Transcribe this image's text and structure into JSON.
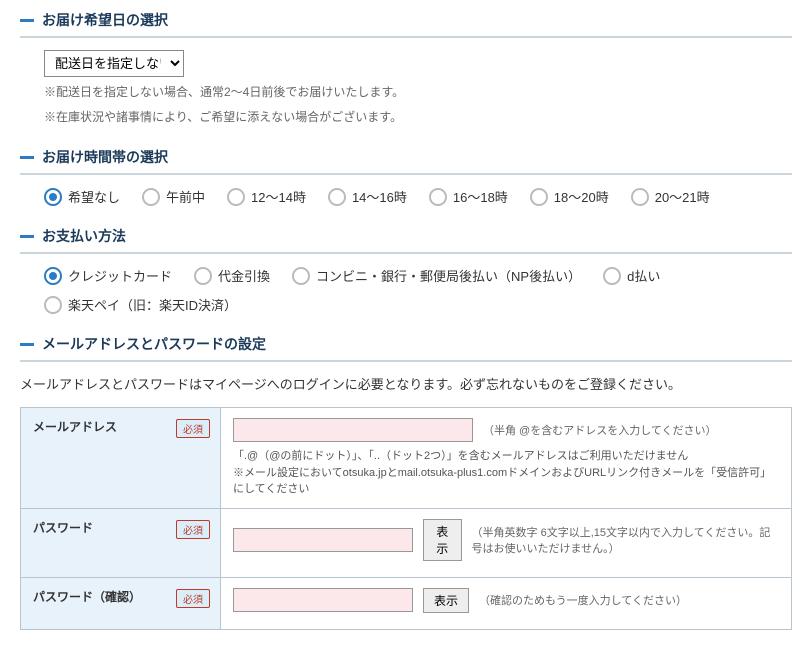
{
  "delivery_date": {
    "title": "お届け希望日の選択",
    "select_value": "配送日を指定しない",
    "note1": "※配送日を指定しない場合、通常2〜4日前後でお届けいたします。",
    "note2": "※在庫状況や諸事情により、ご希望に添えない場合がございます。"
  },
  "delivery_time": {
    "title": "お届け時間帯の選択",
    "options": [
      {
        "label": "希望なし",
        "checked": true
      },
      {
        "label": "午前中",
        "checked": false
      },
      {
        "label": "12〜14時",
        "checked": false
      },
      {
        "label": "14〜16時",
        "checked": false
      },
      {
        "label": "16〜18時",
        "checked": false
      },
      {
        "label": "18〜20時",
        "checked": false
      },
      {
        "label": "20〜21時",
        "checked": false
      }
    ]
  },
  "payment": {
    "title": "お支払い方法",
    "row1": [
      {
        "label": "クレジットカード",
        "checked": true
      },
      {
        "label": "代金引換",
        "checked": false
      },
      {
        "label": "コンビニ・銀行・郵便局後払い（NP後払い）",
        "checked": false
      },
      {
        "label": "d払い",
        "checked": false
      }
    ],
    "row2": [
      {
        "label": "楽天ペイ（旧：楽天ID決済）",
        "checked": false
      }
    ]
  },
  "account": {
    "title": "メールアドレスとパスワードの設定",
    "intro": "メールアドレスとパスワードはマイページへのログインに必要となります。必ず忘れないものをご登録ください。",
    "required_label": "必須",
    "email": {
      "label": "メールアドレス",
      "hint": "（半角 @を含むアドレスを入力してください）",
      "note1": "「.@（@の前にドット）」、「..（ドット2つ）」を含むメールアドレスはご利用いただけません",
      "note2": "※メール設定においてotsuka.jpとmail.otsuka-plus1.comドメインおよびURLリンク付きメールを「受信許可」にしてください"
    },
    "password": {
      "label": "パスワード",
      "show_btn": "表示",
      "hint": "（半角英数字 6文字以上,15文字以内で入力してください。記号はお使いいただけません。）"
    },
    "password_confirm": {
      "label": "パスワード（確認）",
      "show_btn": "表示",
      "hint": "（確認のためもう一度入力してください）"
    }
  }
}
